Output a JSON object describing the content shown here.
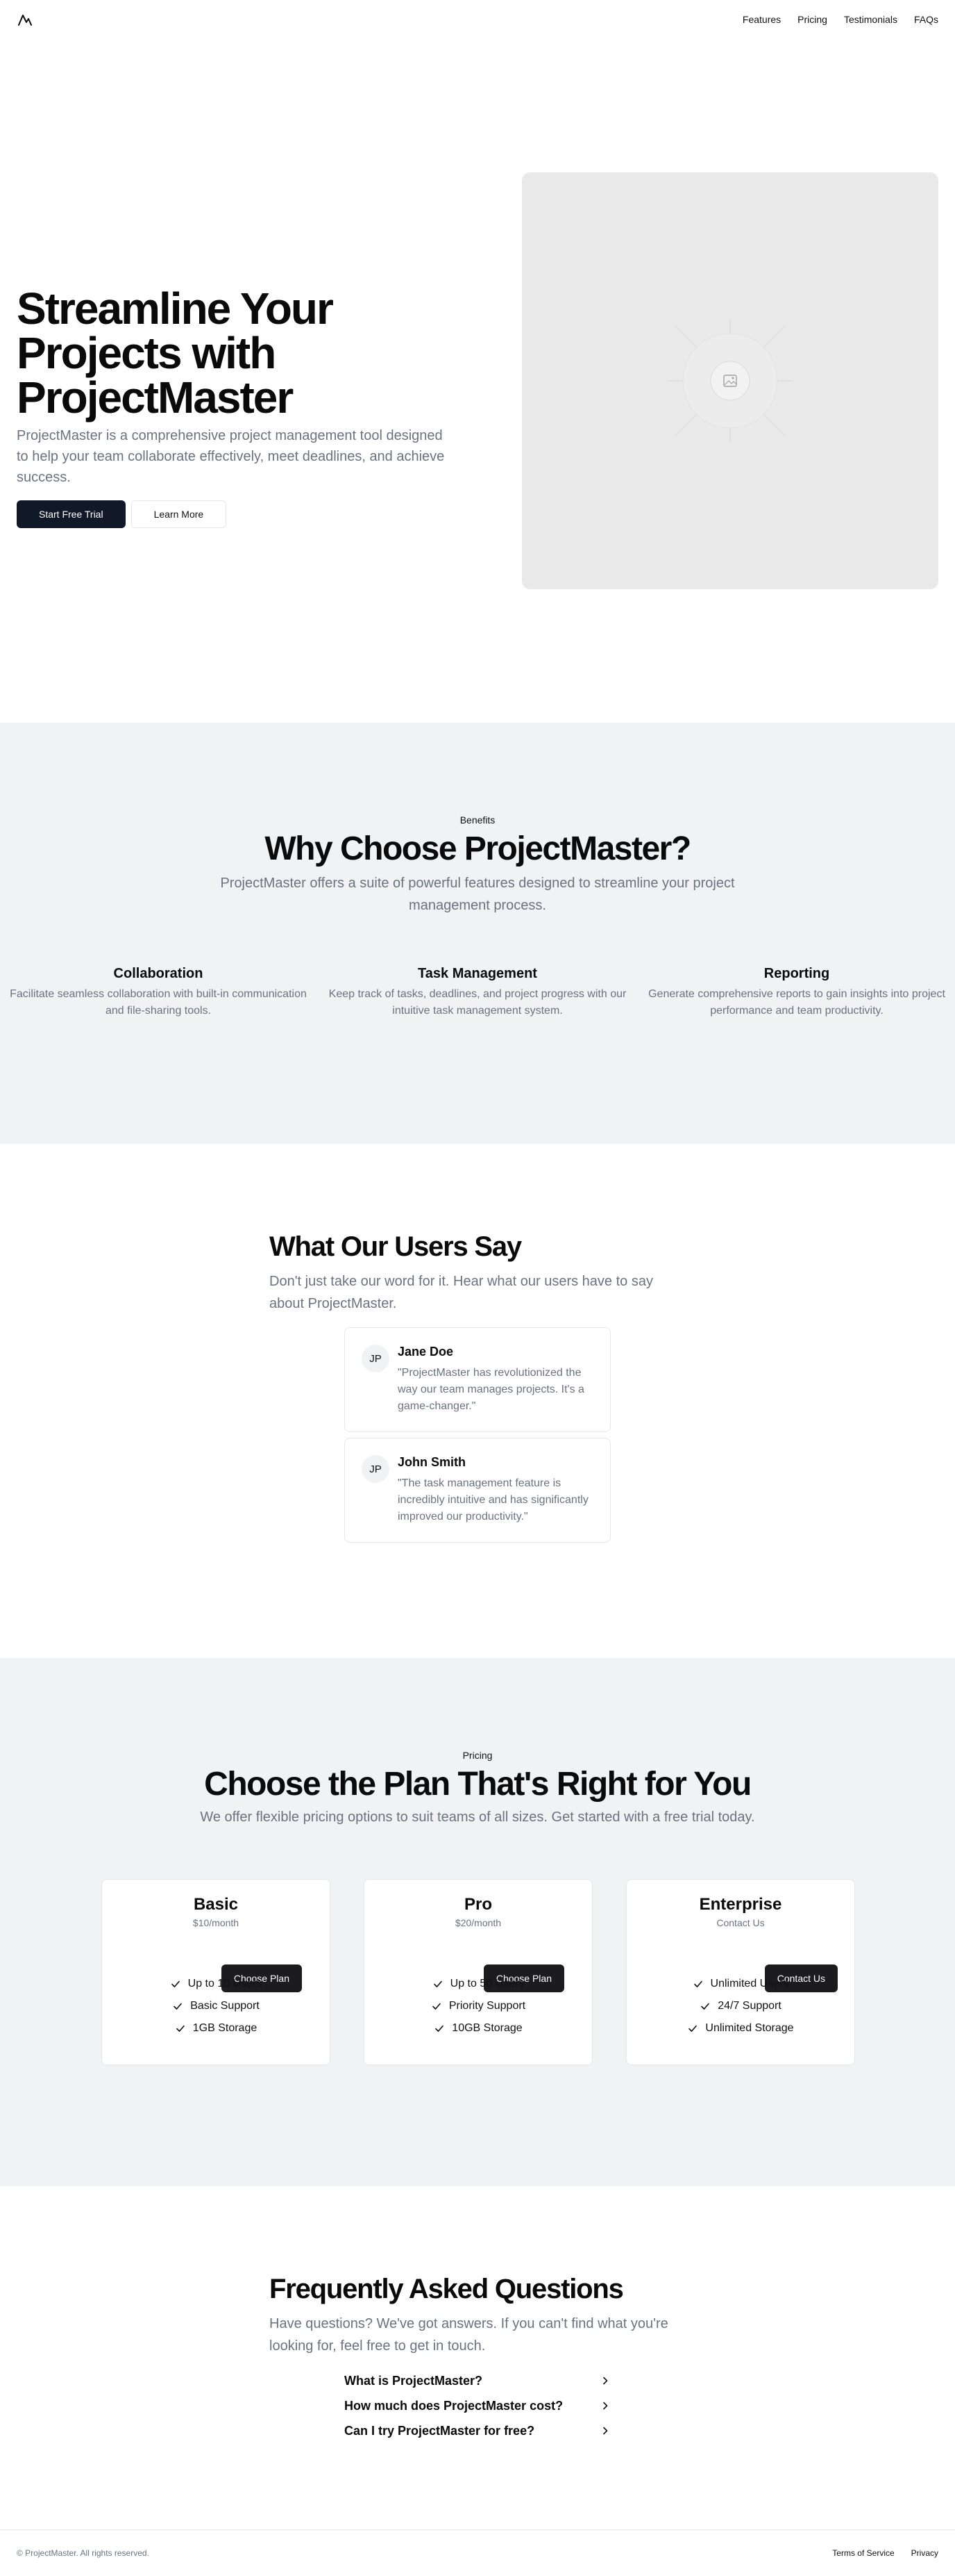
{
  "nav": {
    "links": [
      "Features",
      "Pricing",
      "Testimonials",
      "FAQs"
    ]
  },
  "hero": {
    "title": "Streamline Your Projects with ProjectMaster",
    "subtitle": "ProjectMaster is a comprehensive project management tool designed to help your team collaborate effectively, meet deadlines, and achieve success.",
    "primary_cta": "Start Free Trial",
    "secondary_cta": "Learn More"
  },
  "benefits": {
    "eyebrow": "Benefits",
    "title": "Why Choose ProjectMaster?",
    "subtitle": "ProjectMaster offers a suite of powerful features designed to streamline your project management process.",
    "features": [
      {
        "title": "Collaboration",
        "desc": "Facilitate seamless collaboration with built-in communication and file-sharing tools."
      },
      {
        "title": "Task Management",
        "desc": "Keep track of tasks, deadlines, and project progress with our intuitive task management system."
      },
      {
        "title": "Reporting",
        "desc": "Generate comprehensive reports to gain insights into project performance and team productivity."
      }
    ]
  },
  "testimonials": {
    "title": "What Our Users Say",
    "subtitle": "Don't just take our word for it. Hear what our users have to say about ProjectMaster.",
    "items": [
      {
        "initials": "JP",
        "name": "Jane Doe",
        "quote": "\"ProjectMaster has revolutionized the way our team manages projects. It's a game-changer.\""
      },
      {
        "initials": "JP",
        "name": "John Smith",
        "quote": "\"The task management feature is incredibly intuitive and has significantly improved our productivity.\""
      }
    ]
  },
  "pricing": {
    "eyebrow": "Pricing",
    "title": "Choose the Plan That's Right for You",
    "subtitle": "We offer flexible pricing options to suit teams of all sizes. Get started with a free trial today.",
    "plans": [
      {
        "name": "Basic",
        "price": "$10/month",
        "button": "Choose Plan",
        "features": [
          "Up to 10 Users",
          "Basic Support",
          "1GB Storage"
        ]
      },
      {
        "name": "Pro",
        "price": "$20/month",
        "button": "Choose Plan",
        "features": [
          "Up to 50 Users",
          "Priority Support",
          "10GB Storage"
        ]
      },
      {
        "name": "Enterprise",
        "price": "Contact Us",
        "button": "Contact Us",
        "features": [
          "Unlimited Users",
          "24/7 Support",
          "Unlimited Storage"
        ]
      }
    ]
  },
  "faq": {
    "title": "Frequently Asked Questions",
    "subtitle": "Have questions? We've got answers. If you can't find what you're looking for, feel free to get in touch.",
    "items": [
      "What is ProjectMaster?",
      "How much does ProjectMaster cost?",
      "Can I try ProjectMaster for free?"
    ]
  },
  "footer": {
    "copyright": "© ProjectMaster. All rights reserved.",
    "links": [
      "Terms of Service",
      "Privacy"
    ]
  },
  "colors": {
    "primary_button": "#111827",
    "section_bg": "#f1f2f4",
    "muted_text": "#6b7280",
    "image_placeholder": "#e9e9e9"
  }
}
